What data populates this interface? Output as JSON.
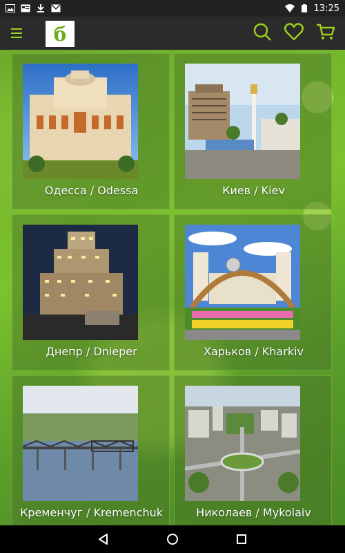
{
  "status": {
    "time": "13:25"
  },
  "app": {
    "logo_letter": "б"
  },
  "cities": [
    {
      "label": "Одесса / Odessa"
    },
    {
      "label": "Киев / Kiev"
    },
    {
      "label": "Днепр / Dnieper"
    },
    {
      "label": "Харьков / Kharkiv"
    },
    {
      "label": "Кременчуг / Kremenchuk"
    },
    {
      "label": "Николаев / Mykolaiv"
    }
  ],
  "icons": {
    "menu": "menu-icon",
    "search": "search-icon",
    "favorite": "heart-icon",
    "cart": "cart-icon"
  },
  "colors": {
    "accent": "#9bd11a",
    "logo": "#6dae1e"
  }
}
